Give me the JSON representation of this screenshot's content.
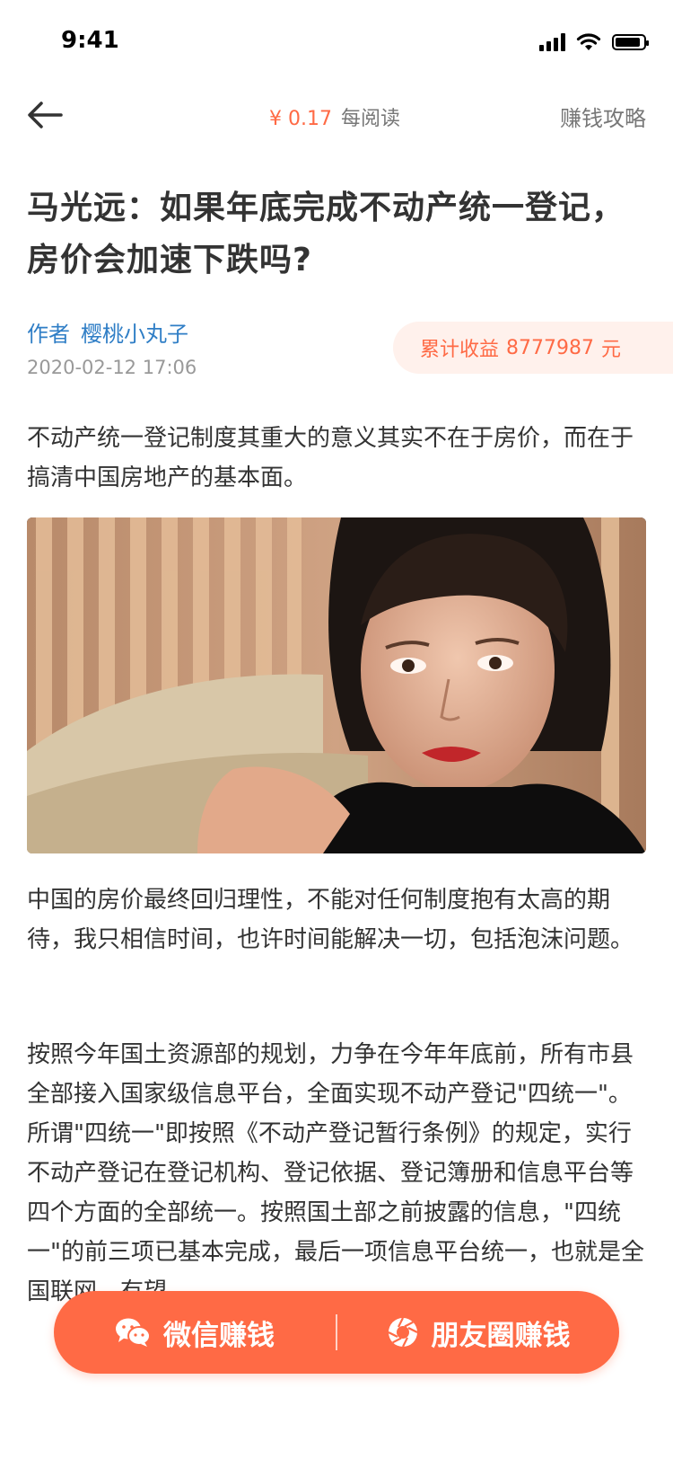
{
  "status_bar": {
    "time": "9:41"
  },
  "nav": {
    "reward_amount": "¥ 0.17",
    "reward_label": "每阅读",
    "guide_label": "赚钱攻略"
  },
  "article": {
    "title": "马光远：如果年底完成不动产统一登记，房价会加速下跌吗?",
    "author_prefix": "作者",
    "author_name": "樱桃小丸子",
    "date": "2020-02-12 17:06",
    "earnings_label": "累计收益",
    "earnings_value": "8777987",
    "earnings_unit": "元",
    "paragraphs": [
      "不动产统一登记制度其重大的意义其实不在于房价，而在于搞清中国房地产的基本面。",
      "中国的房价最终回归理性，不能对任何制度抱有太高的期待，我只相信时间，也许时间能解决一切，包括泡沫问题。",
      "按照今年国土资源部的规划，力争在今年年底前，所有市县全部接入国家级信息平台，全面实现不动产登记\"四统一\"。所谓\"四统一\"即按照《不动产登记暂行条例》的规定，实行不动产登记在登记机构、登记依据、登记簿册和信息平台等四个方面的全部统一。按照国土部之前披露的信息，\"四统一\"的前三项已基本完成，最后一项信息平台统一，也就是全国联网，有望"
    ]
  },
  "share": {
    "wechat_label": "微信赚钱",
    "moments_label": "朋友圈赚钱"
  },
  "colors": {
    "accent": "#ff6a45",
    "author": "#2f7ec6",
    "earnings_bg": "#fff1ec"
  }
}
